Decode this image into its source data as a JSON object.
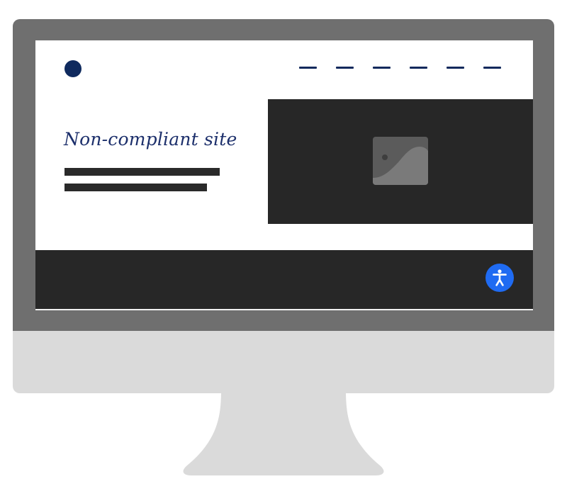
{
  "page": {
    "headline": "Non-compliant site"
  },
  "nav": {
    "items": [
      "",
      "",
      "",
      "",
      "",
      ""
    ]
  },
  "icons": {
    "logo": "circle-logo-icon",
    "image_placeholder": "image-placeholder-icon",
    "accessibility": "accessibility-person-icon"
  },
  "colors": {
    "navy": "#11295c",
    "dark_block": "#272727",
    "accent_blue": "#1f6bf2",
    "bezel": "#6f6f6f",
    "chin": "#dadada"
  }
}
